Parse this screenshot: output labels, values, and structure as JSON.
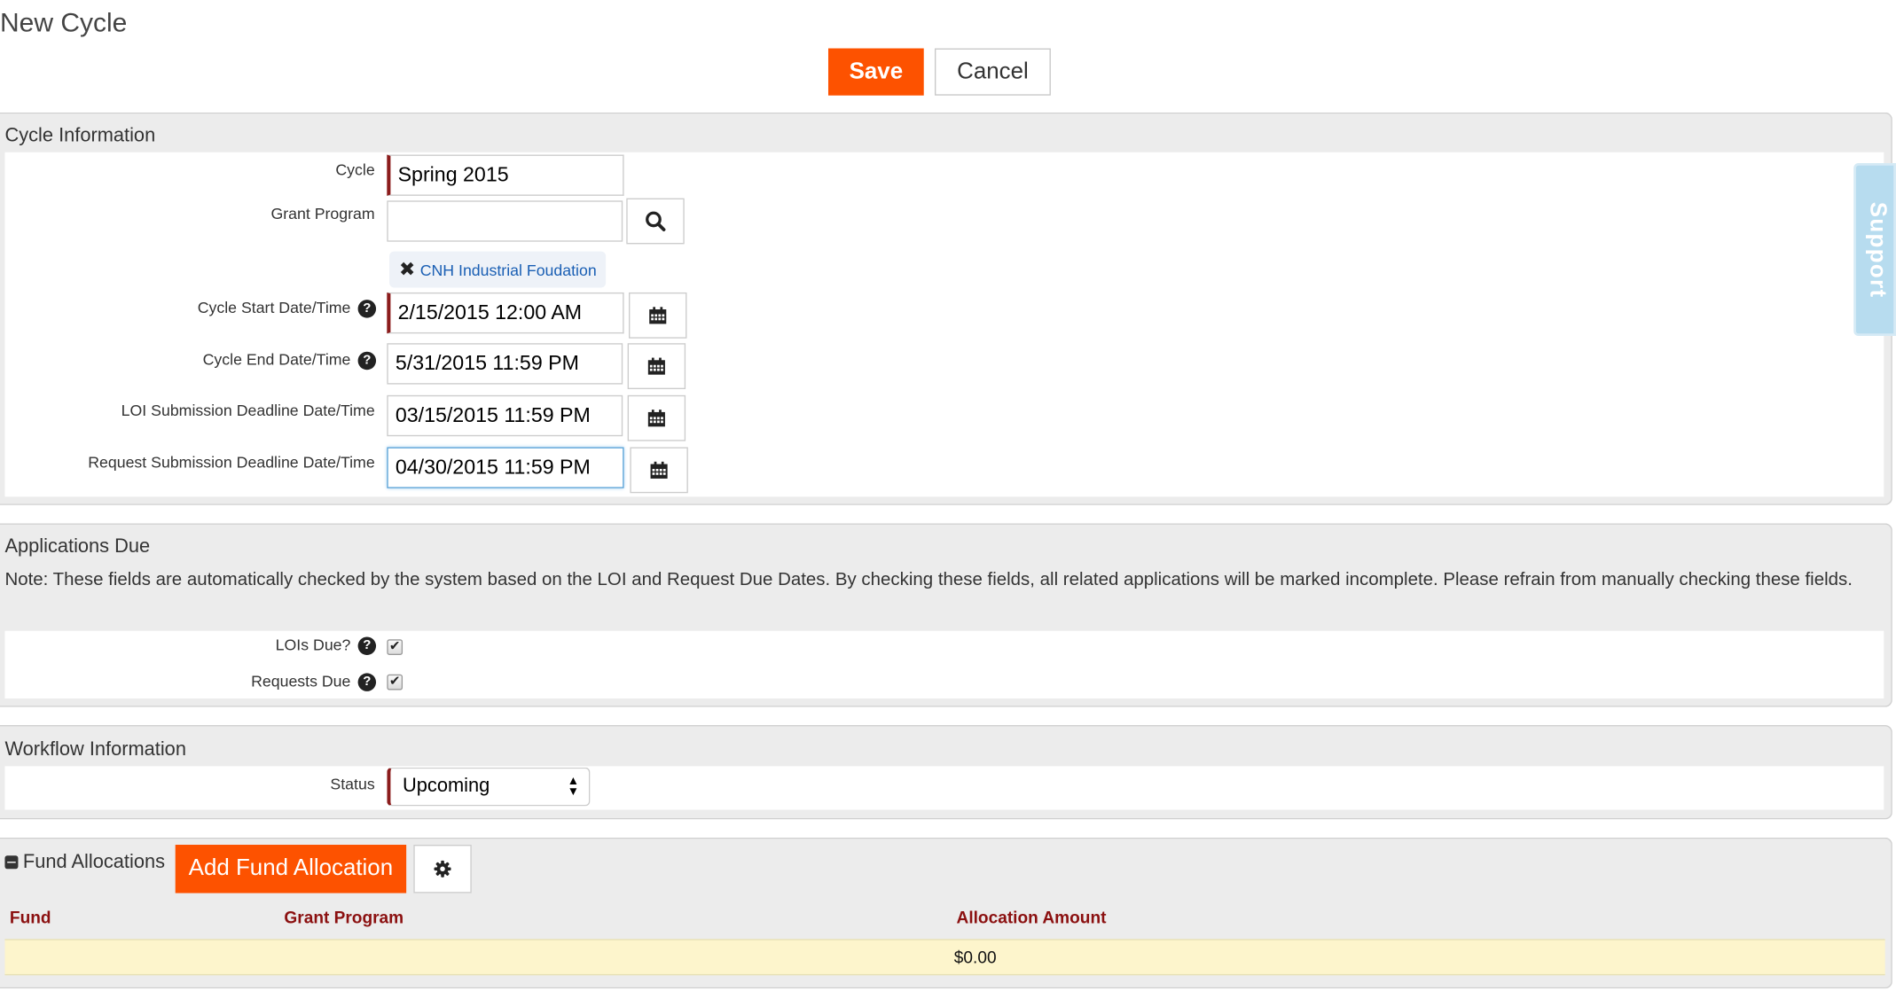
{
  "page": {
    "title": "New Cycle"
  },
  "toolbar": {
    "save_label": "Save",
    "cancel_label": "Cancel"
  },
  "cycle_information": {
    "title": "Cycle Information",
    "cycle_label": "Cycle",
    "cycle_value": "Spring 2015",
    "grant_program_label": "Grant Program",
    "grant_program_value": "",
    "selected_program_tag": "CNH Industrial Foudation",
    "start_label": "Cycle Start Date/Time",
    "start_value": "2/15/2015 12:00 AM",
    "end_label": "Cycle End Date/Time",
    "end_value": "5/31/2015 11:59 PM",
    "loi_deadline_label": "LOI Submission Deadline Date/Time",
    "loi_deadline_value": "03/15/2015 11:59 PM",
    "request_deadline_label": "Request Submission Deadline Date/Time",
    "request_deadline_value": "04/30/2015 11:59 PM"
  },
  "applications_due": {
    "title": "Applications Due",
    "note": "Note: These fields are automatically checked by the system based on the LOI and Request Due Dates. By checking these fields, all related applications will be marked incomplete. Please refrain from manually checking these fields.",
    "lois_due_label": "LOIs Due?",
    "lois_due_checked": true,
    "requests_due_label": "Requests Due",
    "requests_due_checked": true
  },
  "workflow_information": {
    "title": "Workflow Information",
    "status_label": "Status",
    "status_value": "Upcoming"
  },
  "fund_allocations": {
    "title": "Fund Allocations",
    "add_button_label": "Add Fund Allocation",
    "columns": [
      "Fund",
      "Grant Program",
      "Allocation Amount"
    ],
    "total": "$0.00"
  },
  "support_tab": {
    "label": "Support"
  },
  "colors": {
    "accent": "#fd5200",
    "required_marker": "#8b1c1c",
    "header_text": "#8b1010",
    "total_row": "#fdf5cc"
  }
}
